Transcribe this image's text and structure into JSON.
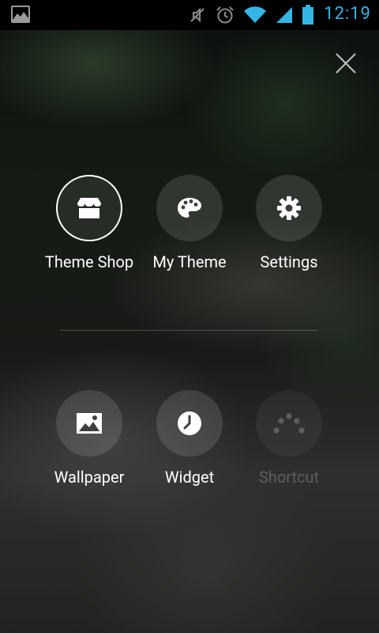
{
  "status_bar": {
    "time": "12:19",
    "icons": [
      "gallery-icon",
      "mute-icon",
      "alarm-icon",
      "wifi-icon",
      "signal-icon",
      "battery-icon"
    ],
    "accent_color": "#33b5e5"
  },
  "menu": {
    "row1": [
      {
        "label": "Theme Shop",
        "icon": "store-icon",
        "state": "active"
      },
      {
        "label": "My Theme",
        "icon": "palette-icon",
        "state": "normal"
      },
      {
        "label": "Settings",
        "icon": "gear-icon",
        "state": "normal"
      }
    ],
    "row2": [
      {
        "label": "Wallpaper",
        "icon": "image-icon",
        "state": "normal"
      },
      {
        "label": "Widget",
        "icon": "clock-icon",
        "state": "normal"
      },
      {
        "label": "Shortcut",
        "icon": "dots-arc-icon",
        "state": "disabled"
      }
    ]
  }
}
